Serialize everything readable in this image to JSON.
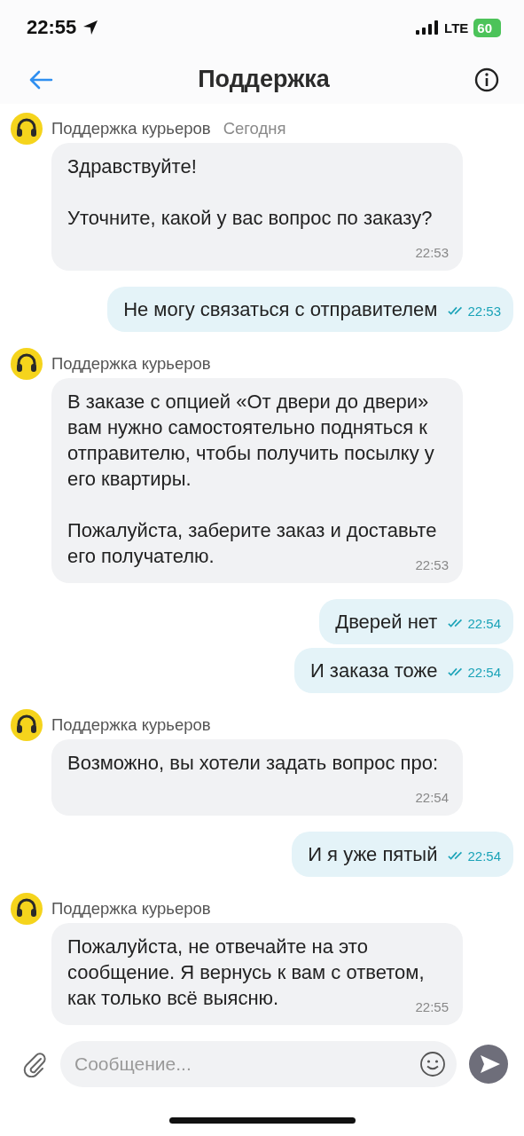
{
  "status_bar": {
    "time": "22:55",
    "network": "LTE",
    "battery": "60"
  },
  "header": {
    "title": "Поддержка"
  },
  "messages": [
    {
      "kind": "incoming",
      "sender": "Поддержка курьеров",
      "date": "Сегодня",
      "text": "Здравствуйте!\n\nУточните, какой у вас вопрос по заказу?",
      "time": "22:53"
    },
    {
      "kind": "outgoing",
      "text": "Не могу связаться с отправителем",
      "time": "22:53",
      "read": true
    },
    {
      "kind": "incoming",
      "sender": "Поддержка курьеров",
      "text": "В заказе с опцией «От двери до двери» вам нужно самостоятельно подняться к отправителю, чтобы получить посылку у его квартиры.\n\nПожалуйста, заберите заказ и доставьте его получателю.",
      "time": "22:53"
    },
    {
      "kind": "outgoing",
      "text": "Дверей нет",
      "time": "22:54",
      "read": true
    },
    {
      "kind": "outgoing",
      "text": "И заказа тоже",
      "time": "22:54",
      "read": true
    },
    {
      "kind": "incoming",
      "sender": "Поддержка курьеров",
      "text": "Возможно, вы хотели задать вопрос про:",
      "time": "22:54"
    },
    {
      "kind": "outgoing",
      "text": "И я уже пятый",
      "time": "22:54",
      "read": true
    },
    {
      "kind": "incoming",
      "sender": "Поддержка курьеров",
      "text": "Пожалуйста, не отвечайте на это сообщение. Я вернусь к вам с ответом, как только всё выясню.",
      "time": "22:55"
    }
  ],
  "composer": {
    "placeholder": "Сообщение..."
  }
}
